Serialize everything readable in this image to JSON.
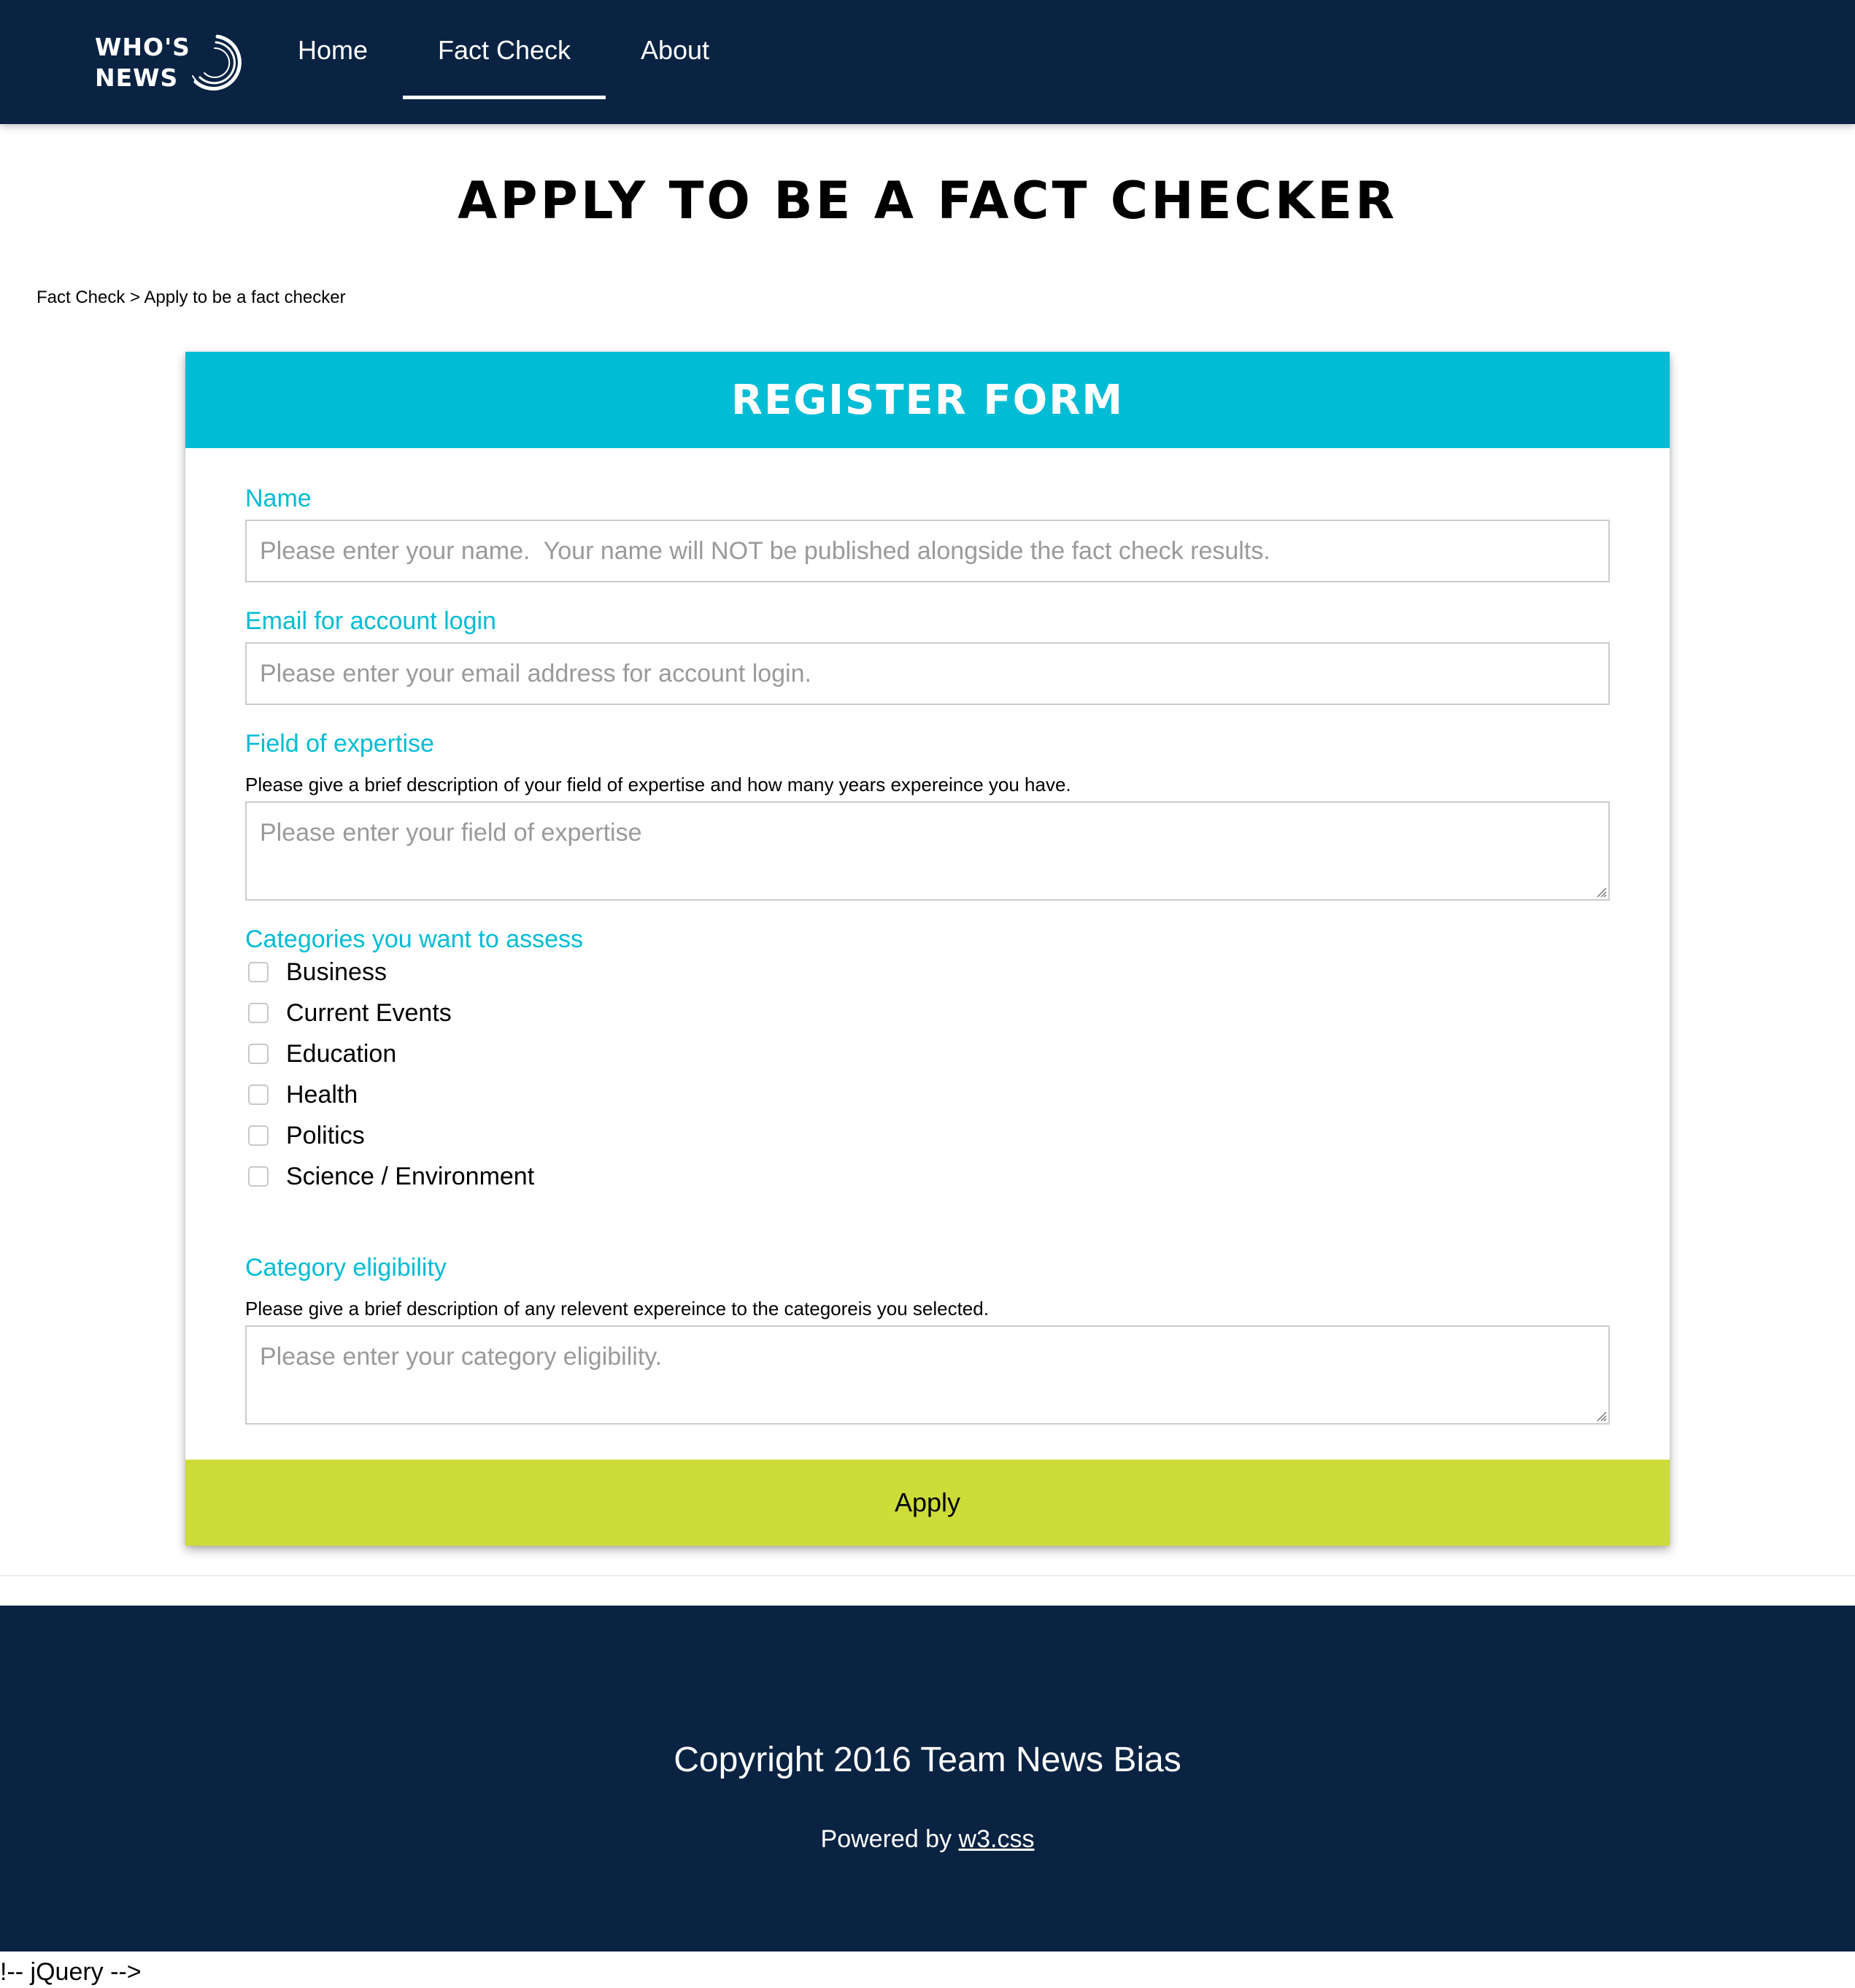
{
  "colors": {
    "navy": "#0a2342",
    "accent_cyan": "#00bcd4",
    "apply_lime": "#cddc39",
    "input_border": "#cccccc",
    "placeholder": "#9a9a9a"
  },
  "brand": {
    "logo_line1": "WHO'S",
    "logo_line2": "NEWS",
    "logo_icon": "swirl-icon"
  },
  "nav": {
    "home": "Home",
    "fact_check": "Fact Check",
    "about": "About",
    "active": "Fact Check"
  },
  "page": {
    "title": "APPLY TO BE A FACT CHECKER"
  },
  "breadcrumb": {
    "parent": "Fact Check",
    "separator": ">",
    "current": "Apply to be a fact checker"
  },
  "form": {
    "header": "REGISTER FORM",
    "name": {
      "label": "Name",
      "value": "",
      "placeholder": "Please enter your name.  Your name will NOT be published alongside the fact check results."
    },
    "email": {
      "label": "Email for account login",
      "value": "",
      "placeholder": "Please enter your email address for account login."
    },
    "expertise": {
      "label": "Field of expertise",
      "help": "Please give a brief description of your field of expertise and how many years expereince you have.",
      "value": "",
      "placeholder": "Please enter your field of expertise"
    },
    "categories": {
      "label": "Categories you want to assess",
      "items": [
        {
          "label": "Business",
          "checked": false
        },
        {
          "label": "Current Events",
          "checked": false
        },
        {
          "label": "Education",
          "checked": false
        },
        {
          "label": "Health",
          "checked": false
        },
        {
          "label": "Politics",
          "checked": false
        },
        {
          "label": "Science / Environment",
          "checked": false
        }
      ]
    },
    "eligibility": {
      "label": "Category eligibility",
      "help": "Please give a brief description of any relevent expereince to the categoreis you selected.",
      "value": "",
      "placeholder": "Please enter your category eligibility."
    },
    "apply_label": "Apply"
  },
  "footer": {
    "copyright": "Copyright 2016 Team News Bias",
    "powered_prefix": "Powered by",
    "powered_link": "w3.css"
  },
  "stray_text": "!-- jQuery -->"
}
